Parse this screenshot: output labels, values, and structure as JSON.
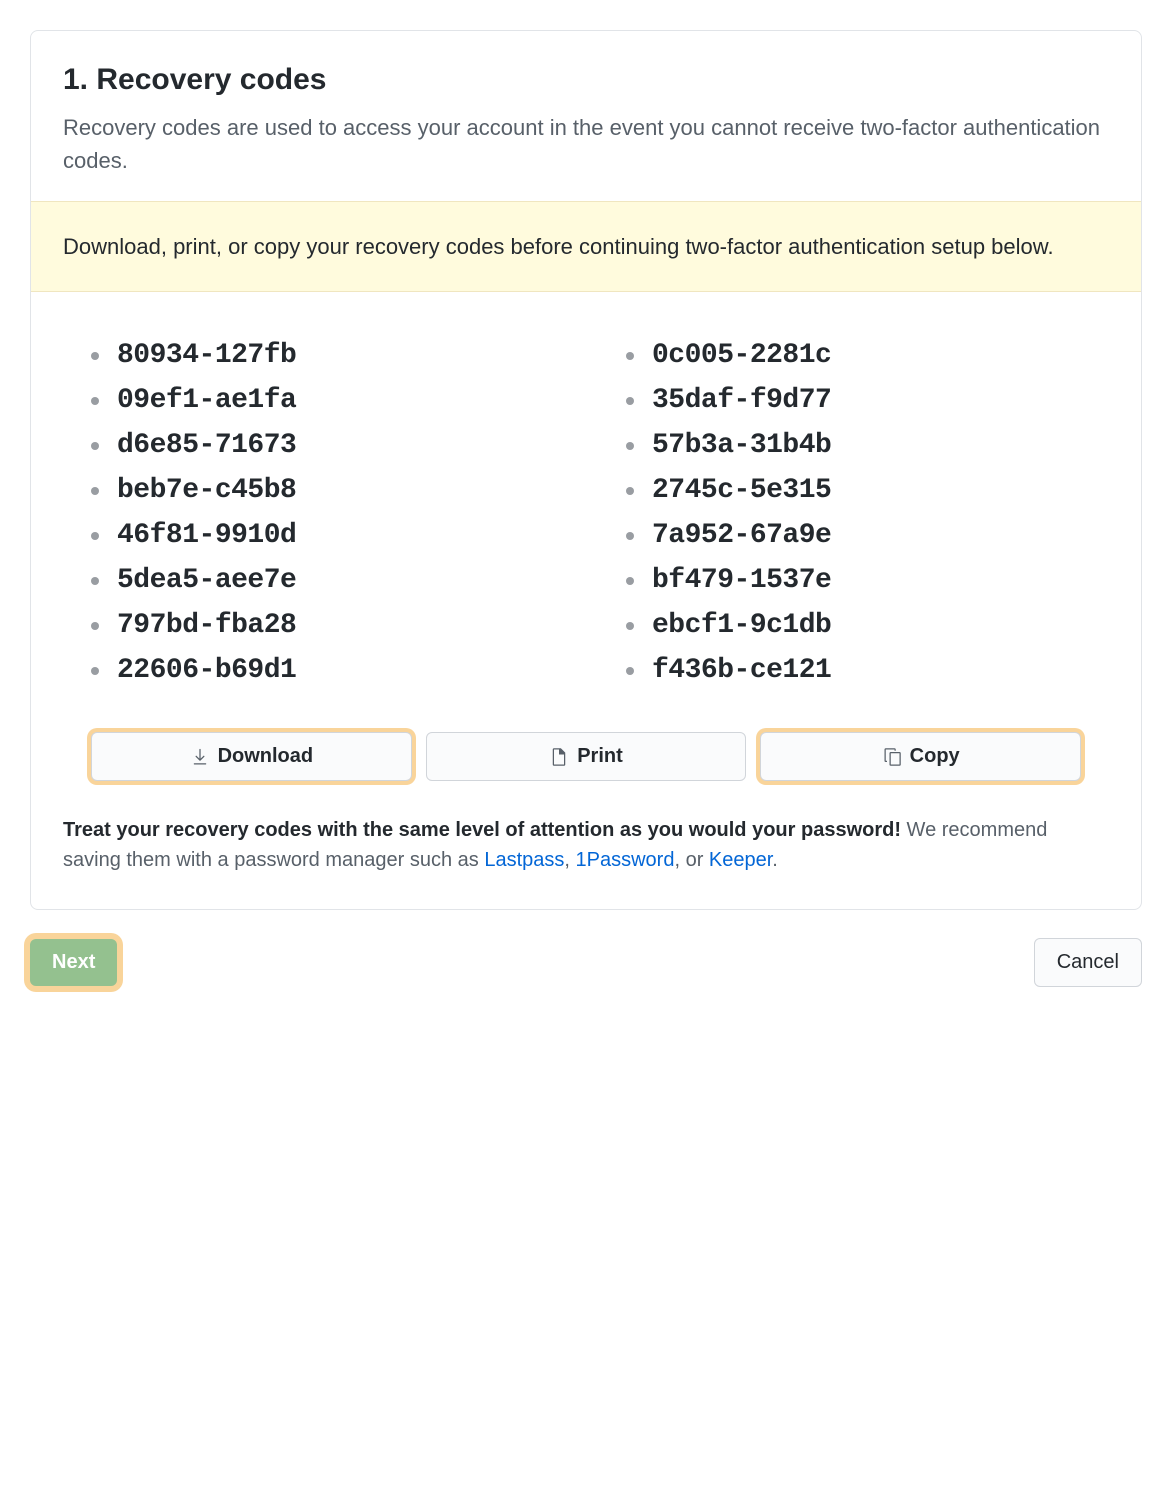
{
  "header": {
    "title": "1. Recovery codes",
    "subtitle": "Recovery codes are used to access your account in the event you cannot receive two-factor authentication codes."
  },
  "banner": {
    "text": "Download, print, or copy your recovery codes before continuing two-factor authentication setup below."
  },
  "codes": {
    "col1": [
      "80934-127fb",
      "09ef1-ae1fa",
      "d6e85-71673",
      "beb7e-c45b8",
      "46f81-9910d",
      "5dea5-aee7e",
      "797bd-fba28",
      "22606-b69d1"
    ],
    "col2": [
      "0c005-2281c",
      "35daf-f9d77",
      "57b3a-31b4b",
      "2745c-5e315",
      "7a952-67a9e",
      "bf479-1537e",
      "ebcf1-9c1db",
      "f436b-ce121"
    ]
  },
  "actions": {
    "download": "Download",
    "print": "Print",
    "copy": "Copy"
  },
  "footer": {
    "strong": "Treat your recovery codes with the same level of attention as you would your password!",
    "text": " We recommend saving them with a password manager such as ",
    "link1": "Lastpass",
    "sep1": ", ",
    "link2": "1Password",
    "sep2": ", or ",
    "link3": "Keeper",
    "end": "."
  },
  "bottom": {
    "next": "Next",
    "cancel": "Cancel"
  }
}
